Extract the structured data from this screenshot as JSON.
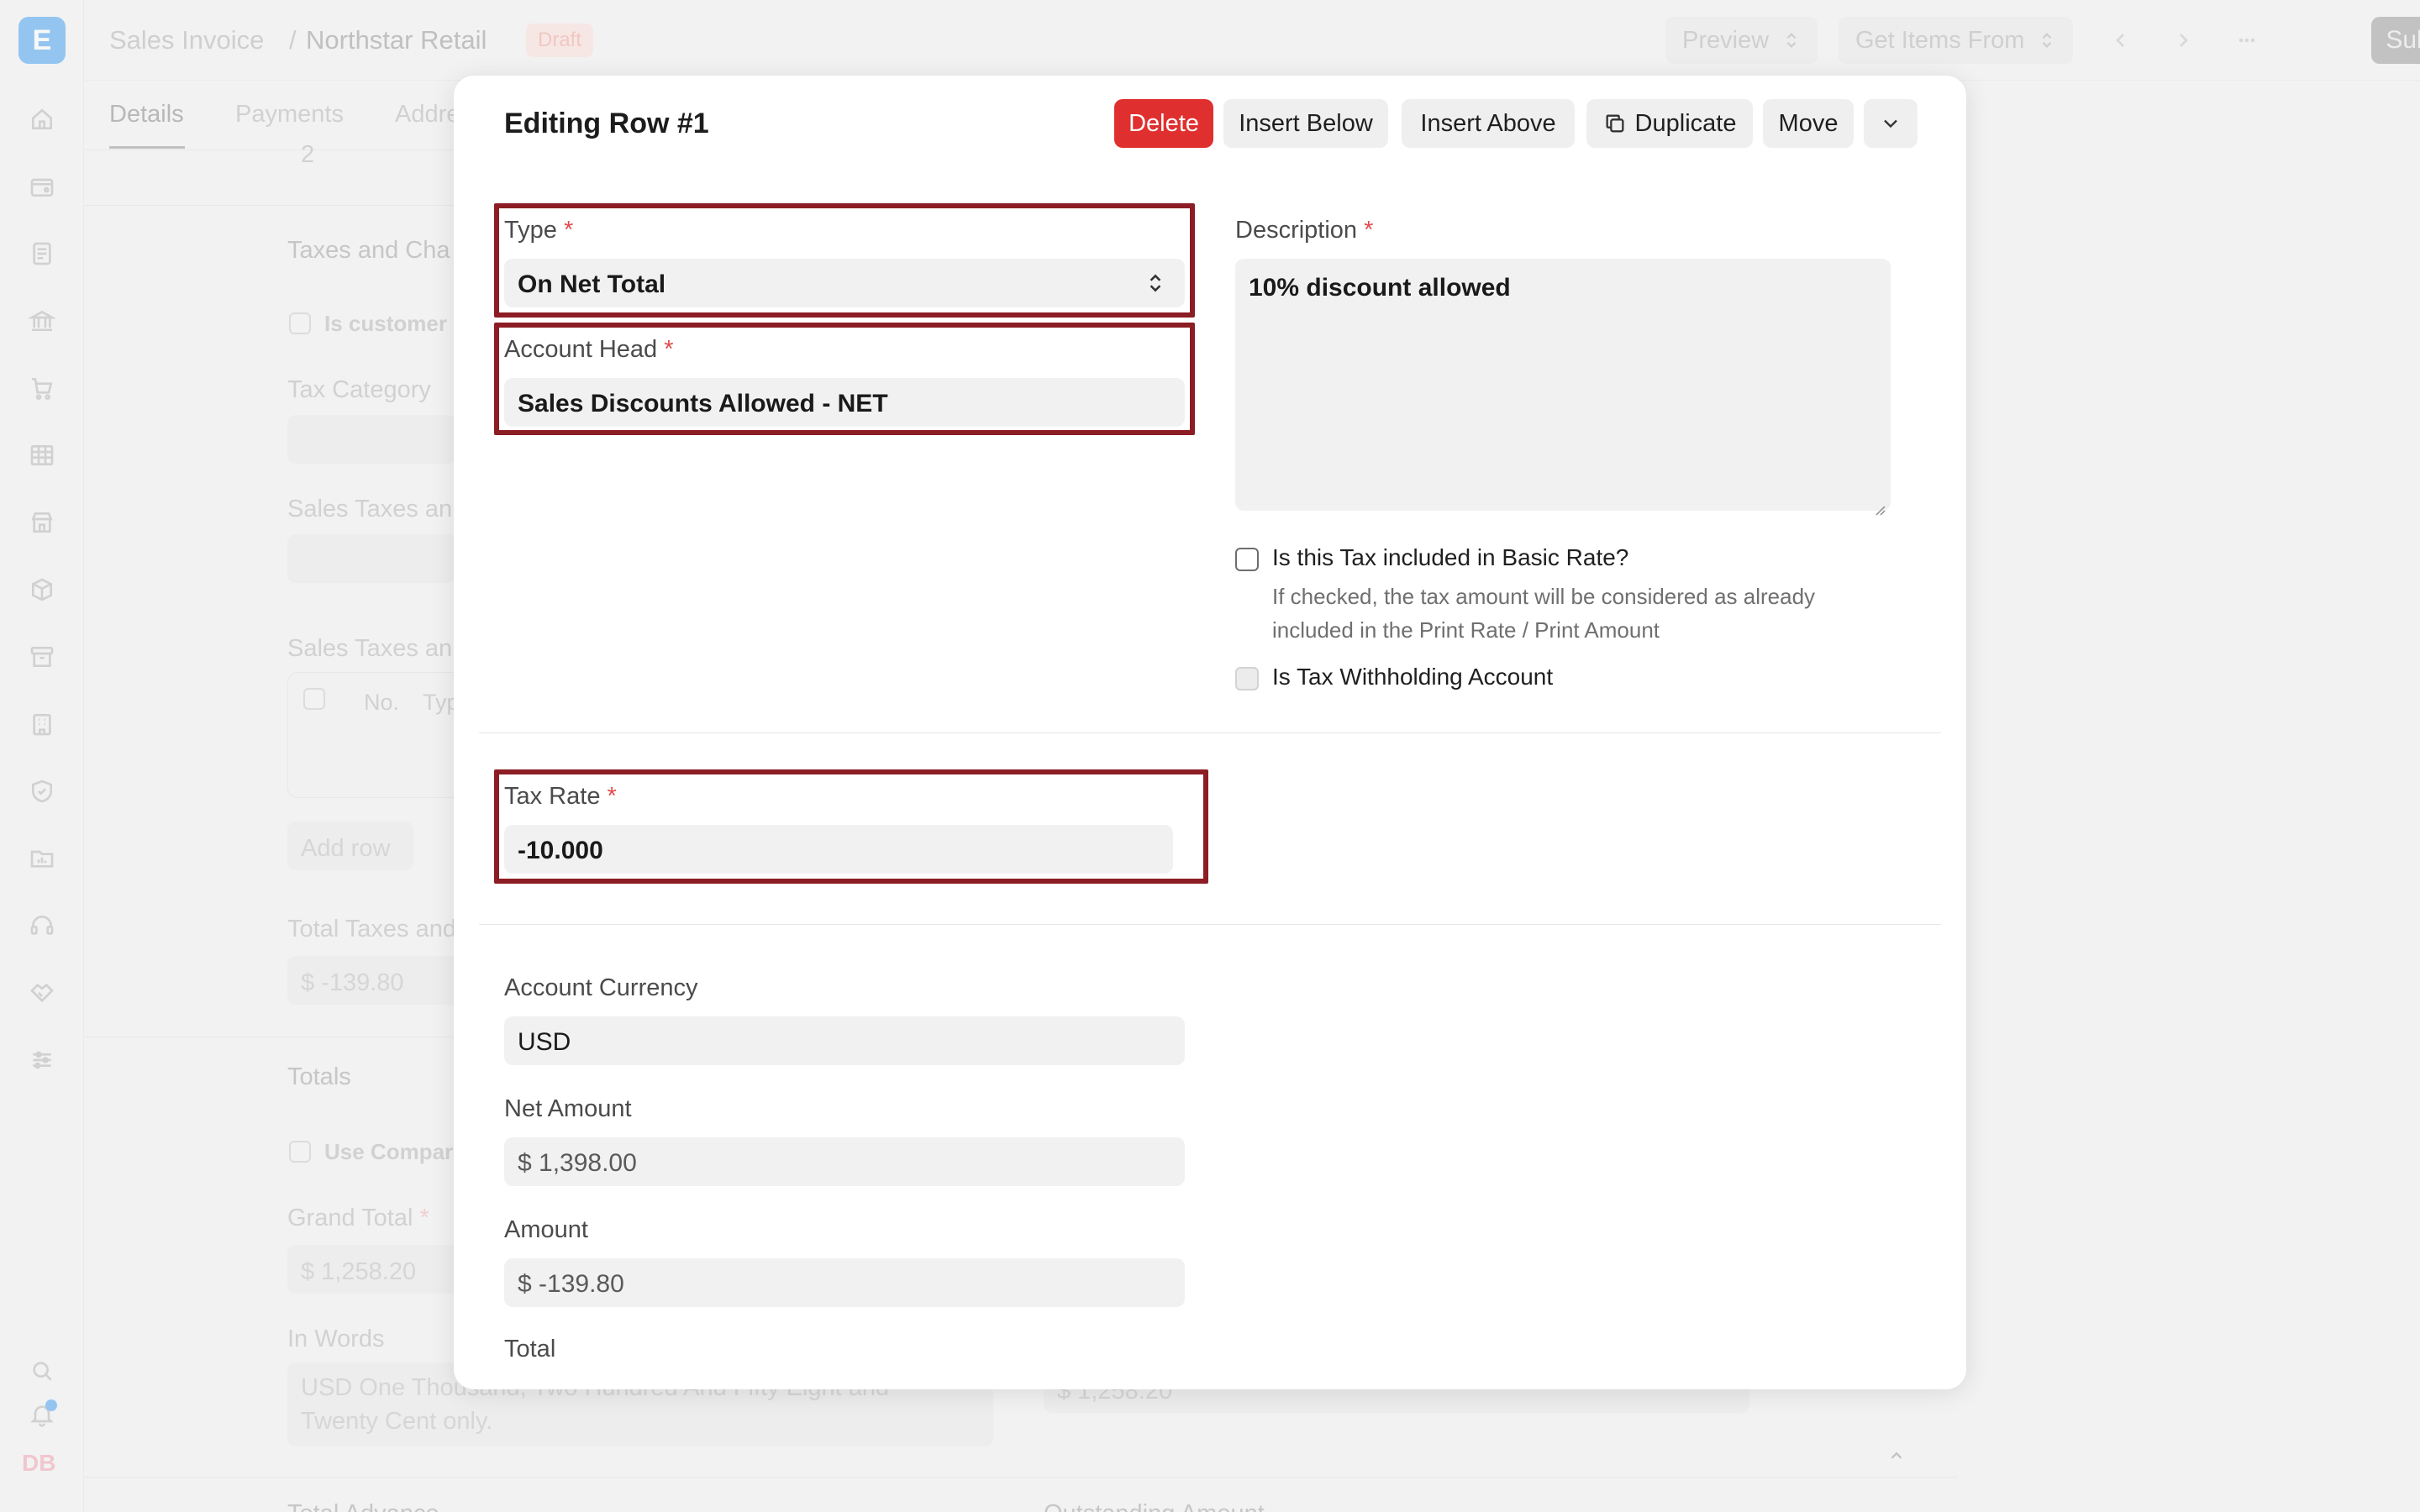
{
  "app": {
    "logo_letter": "E",
    "user_initials": "DB"
  },
  "header": {
    "breadcrumb_doctype": "Sales Invoice",
    "breadcrumb_sep": "/",
    "breadcrumb_name": "Northstar Retail",
    "status_badge": "Draft",
    "preview_label": "Preview",
    "get_items_label": "Get Items From",
    "submit_label": "Submit"
  },
  "background_form": {
    "tabs": [
      "Details",
      "Payments",
      "Addre"
    ],
    "qty_value": "2",
    "section_taxes": "Taxes and Cha",
    "is_customer": "Is customer",
    "tax_category": "Tax Category",
    "sales_taxes_1": "Sales Taxes an",
    "sales_taxes_2": "Sales Taxes an",
    "table_no": "No.",
    "table_type": "Typ",
    "add_row": "Add row",
    "total_taxes": "Total Taxes and",
    "total_taxes_value": "$ -139.80",
    "totals_heading": "Totals",
    "use_company": "Use Compar",
    "grand_total": "Grand Total",
    "grand_total_value": "$ 1,258.20",
    "in_words": "In Words",
    "in_words_value_1": "USD One Thousand, Two Hundred And Fifty Eight and",
    "in_words_value_2": "Twenty Cent only.",
    "right_amount_value": "$ 1,258.20",
    "bottom_label_left": "Total Advance",
    "bottom_label_right": "Outstanding Amount"
  },
  "modal": {
    "title": "Editing Row #1",
    "buttons": {
      "delete": "Delete",
      "insert_below": "Insert Below",
      "insert_above": "Insert Above",
      "duplicate": "Duplicate",
      "move": "Move"
    },
    "type": {
      "label": "Type",
      "value": "On Net Total"
    },
    "account_head": {
      "label": "Account Head",
      "value": "Sales Discounts Allowed - NET"
    },
    "description": {
      "label": "Description",
      "value": "10% discount allowed"
    },
    "included_in_basic_rate": {
      "label": "Is this Tax included in Basic Rate?",
      "help_1": "If checked, the tax amount will be considered as already",
      "help_2": "included in the Print Rate / Print Amount",
      "checked": false
    },
    "tax_withholding": {
      "label": "Is Tax Withholding Account",
      "checked": false
    },
    "tax_rate": {
      "label": "Tax Rate",
      "value": "-10.000"
    },
    "account_currency": {
      "label": "Account Currency",
      "value": "USD"
    },
    "net_amount": {
      "label": "Net Amount",
      "value": "$ 1,398.00"
    },
    "amount": {
      "label": "Amount",
      "value": "$ -139.80"
    },
    "total": {
      "label": "Total"
    },
    "required_mark": "*"
  },
  "colors": {
    "danger": "#e02f2f",
    "highlight_border": "#8c1d24",
    "accent_blue": "#4aa3f0"
  }
}
